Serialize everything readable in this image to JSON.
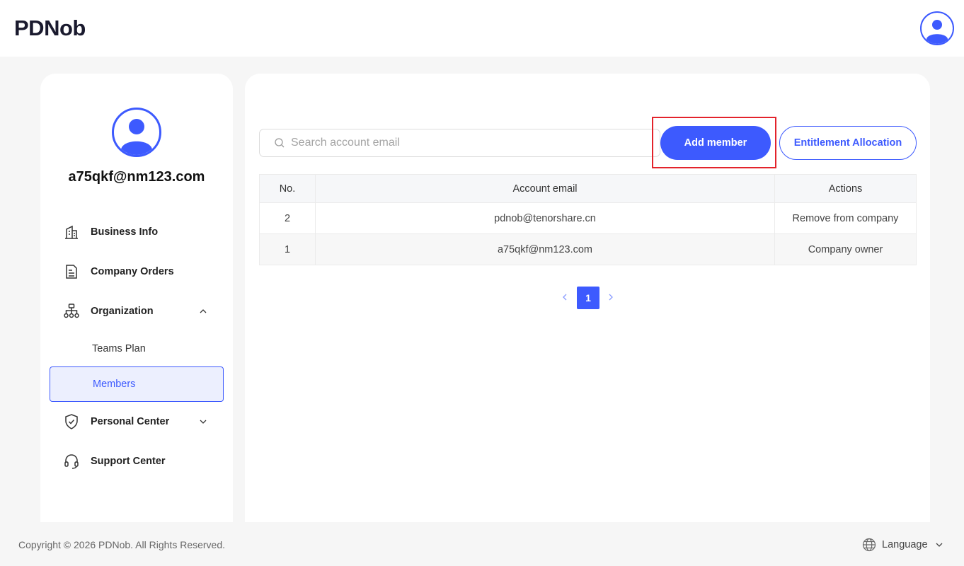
{
  "header": {
    "logo": "PDNob"
  },
  "account": {
    "email": "a75qkf@nm123.com"
  },
  "sidebar": {
    "items": [
      {
        "label": "Business Info",
        "icon": "building-icon"
      },
      {
        "label": "Company Orders",
        "icon": "document-icon"
      },
      {
        "label": "Organization",
        "icon": "org-chart-icon",
        "expanded": true
      },
      {
        "label": "Personal Center",
        "icon": "shield-check-icon",
        "expanded": false
      },
      {
        "label": "Support Center",
        "icon": "headset-icon"
      }
    ],
    "sub_items": [
      {
        "label": "Teams Plan",
        "active": false
      },
      {
        "label": "Members",
        "active": true
      }
    ]
  },
  "toolbar": {
    "search_placeholder": "Search account email",
    "add_member": "Add member",
    "entitlement": "Entitlement Allocation"
  },
  "table": {
    "headers": [
      "No.",
      "Account email",
      "Actions"
    ],
    "rows": [
      {
        "no": "2",
        "email": "pdnob@tenorshare.cn",
        "action": "Remove from company"
      },
      {
        "no": "1",
        "email": "a75qkf@nm123.com",
        "action": "Company owner"
      }
    ]
  },
  "pagination": {
    "current": "1"
  },
  "footer": {
    "copyright": "Copyright © 2026 PDNob. All Rights Reserved.",
    "language": "Language"
  },
  "colors": {
    "accent": "#3d5afe",
    "highlight": "#e3232b",
    "background": "#f6f6f6"
  }
}
